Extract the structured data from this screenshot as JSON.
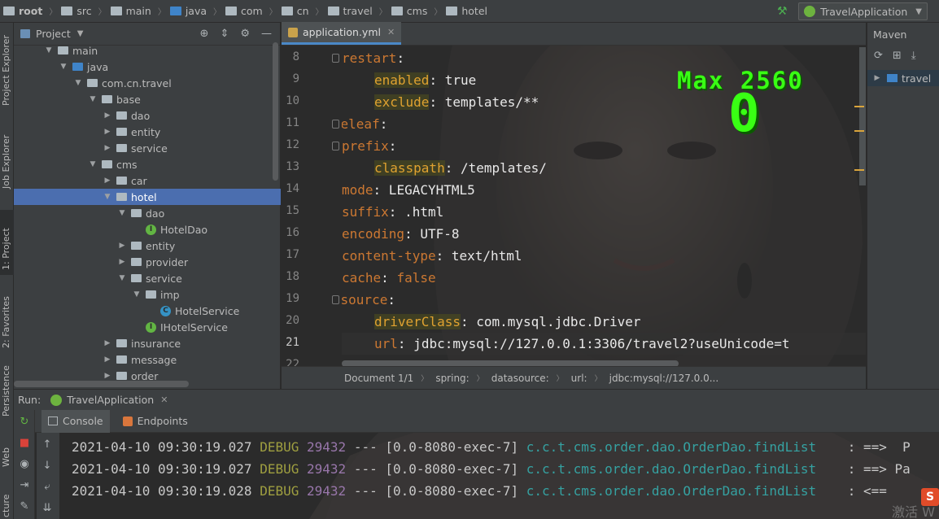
{
  "breadcrumb": [
    "root",
    "src",
    "main",
    "java",
    "com",
    "cn",
    "travel",
    "cms",
    "hotel"
  ],
  "run_config": {
    "label": "TravelApplication"
  },
  "left_strip": [
    "Project Explorer",
    "Job Explorer",
    "1: Project",
    "2: Favorites",
    "Persistence",
    "Web",
    "cture"
  ],
  "project_panel": {
    "title": "Project",
    "tree": [
      {
        "label": "main",
        "depth": 2,
        "icon": "folder",
        "expanded": true
      },
      {
        "label": "java",
        "depth": 3,
        "icon": "folder-blue",
        "expanded": true
      },
      {
        "label": "com.cn.travel",
        "depth": 4,
        "icon": "package",
        "expanded": true
      },
      {
        "label": "base",
        "depth": 5,
        "icon": "package",
        "expanded": true
      },
      {
        "label": "dao",
        "depth": 6,
        "icon": "package",
        "expanded": false
      },
      {
        "label": "entity",
        "depth": 6,
        "icon": "package",
        "expanded": false
      },
      {
        "label": "service",
        "depth": 6,
        "icon": "package",
        "expanded": false
      },
      {
        "label": "cms",
        "depth": 5,
        "icon": "package",
        "expanded": true
      },
      {
        "label": "car",
        "depth": 6,
        "icon": "package",
        "expanded": false
      },
      {
        "label": "hotel",
        "depth": 6,
        "icon": "package",
        "expanded": true,
        "selected": true
      },
      {
        "label": "dao",
        "depth": 7,
        "icon": "package",
        "expanded": true
      },
      {
        "label": "HotelDao",
        "depth": 8,
        "icon": "interface"
      },
      {
        "label": "entity",
        "depth": 7,
        "icon": "package",
        "expanded": false
      },
      {
        "label": "provider",
        "depth": 7,
        "icon": "package",
        "expanded": false
      },
      {
        "label": "service",
        "depth": 7,
        "icon": "package",
        "expanded": true
      },
      {
        "label": "imp",
        "depth": 8,
        "icon": "package",
        "expanded": true
      },
      {
        "label": "HotelService",
        "depth": 9,
        "icon": "class"
      },
      {
        "label": "IHotelService",
        "depth": 8,
        "icon": "interface"
      },
      {
        "label": "insurance",
        "depth": 6,
        "icon": "package",
        "expanded": false
      },
      {
        "label": "message",
        "depth": 6,
        "icon": "package",
        "expanded": false
      },
      {
        "label": "order",
        "depth": 6,
        "icon": "package",
        "expanded": false
      }
    ]
  },
  "editor": {
    "tab": "application.yml",
    "lines": [
      {
        "n": "8",
        "indent": 2,
        "key": "restart",
        "sep": ":",
        "val": ""
      },
      {
        "n": "9",
        "indent": 3,
        "key": "enabled",
        "sep": ":",
        "val": " true",
        "highlight": true
      },
      {
        "n": "10",
        "indent": 3,
        "key": "exclude",
        "sep": ":",
        "val": " templates/**",
        "highlight": true
      },
      {
        "n": "11",
        "indent": 1,
        "key": "thymeleaf",
        "sep": ":",
        "val": ""
      },
      {
        "n": "12",
        "indent": 2,
        "key": "prefix",
        "sep": ":",
        "val": ""
      },
      {
        "n": "13",
        "indent": 3,
        "key": "classpath",
        "sep": ":",
        "val": " /templates/",
        "highlight": true
      },
      {
        "n": "14",
        "indent": 2,
        "key": "mode",
        "sep": ":",
        "val": " LEGACYHTML5"
      },
      {
        "n": "15",
        "indent": 2,
        "key": "suffix",
        "sep": ":",
        "val": " .html"
      },
      {
        "n": "16",
        "indent": 2,
        "key": "encoding",
        "sep": ":",
        "val": " UTF-8"
      },
      {
        "n": "17",
        "indent": 2,
        "key": "content-type",
        "sep": ":",
        "val": " text/html"
      },
      {
        "n": "18",
        "indent": 2,
        "key": "cache",
        "sep": ":",
        "val": " false",
        "valkw": true
      },
      {
        "n": "19",
        "indent": 1,
        "key": "datasource",
        "sep": ":",
        "val": ""
      },
      {
        "n": "20",
        "indent": 3,
        "key": "driverClass",
        "sep": ":",
        "val": " com.mysql.jdbc.Driver",
        "highlight": true
      },
      {
        "n": "21",
        "indent": 3,
        "key": "url",
        "sep": ":",
        "val": " jdbc:mysql://127.0.0.1:3306/travel2?useUnicode=t",
        "current": true
      },
      {
        "n": "22",
        "indent": 3,
        "key": "username",
        "sep": ":",
        "val": " root"
      }
    ],
    "status_path": [
      "Document 1/1",
      "spring:",
      "datasource:",
      "url:",
      "jdbc:mysql://127.0.0..."
    ]
  },
  "overlay": {
    "max_label": "Max 2560",
    "score": "0"
  },
  "maven": {
    "title": "Maven",
    "project": "travel"
  },
  "run": {
    "label": "Run:",
    "tab": "TravelApplication",
    "subtabs": [
      "Console",
      "Endpoints"
    ],
    "log": [
      {
        "ts": "2021-04-10 09:30:19.027",
        "level": "DEBUG",
        "pid": "29432",
        "thread": "--- [0.0-8080-exec-7]",
        "logger": "c.c.t.cms.order.dao.OrderDao.findList",
        "msg": "   : ==>  P"
      },
      {
        "ts": "2021-04-10 09:30:19.027",
        "level": "DEBUG",
        "pid": "29432",
        "thread": "--- [0.0-8080-exec-7]",
        "logger": "c.c.t.cms.order.dao.OrderDao.findList",
        "msg": "   : ==> Pa"
      },
      {
        "ts": "2021-04-10 09:30:19.028",
        "level": "DEBUG",
        "pid": "29432",
        "thread": "--- [0.0-8080-exec-7]",
        "logger": "c.c.t.cms.order.dao.OrderDao.findList",
        "msg": "   : <=="
      }
    ]
  },
  "watermark": "激活 W",
  "ime_badge": "S"
}
